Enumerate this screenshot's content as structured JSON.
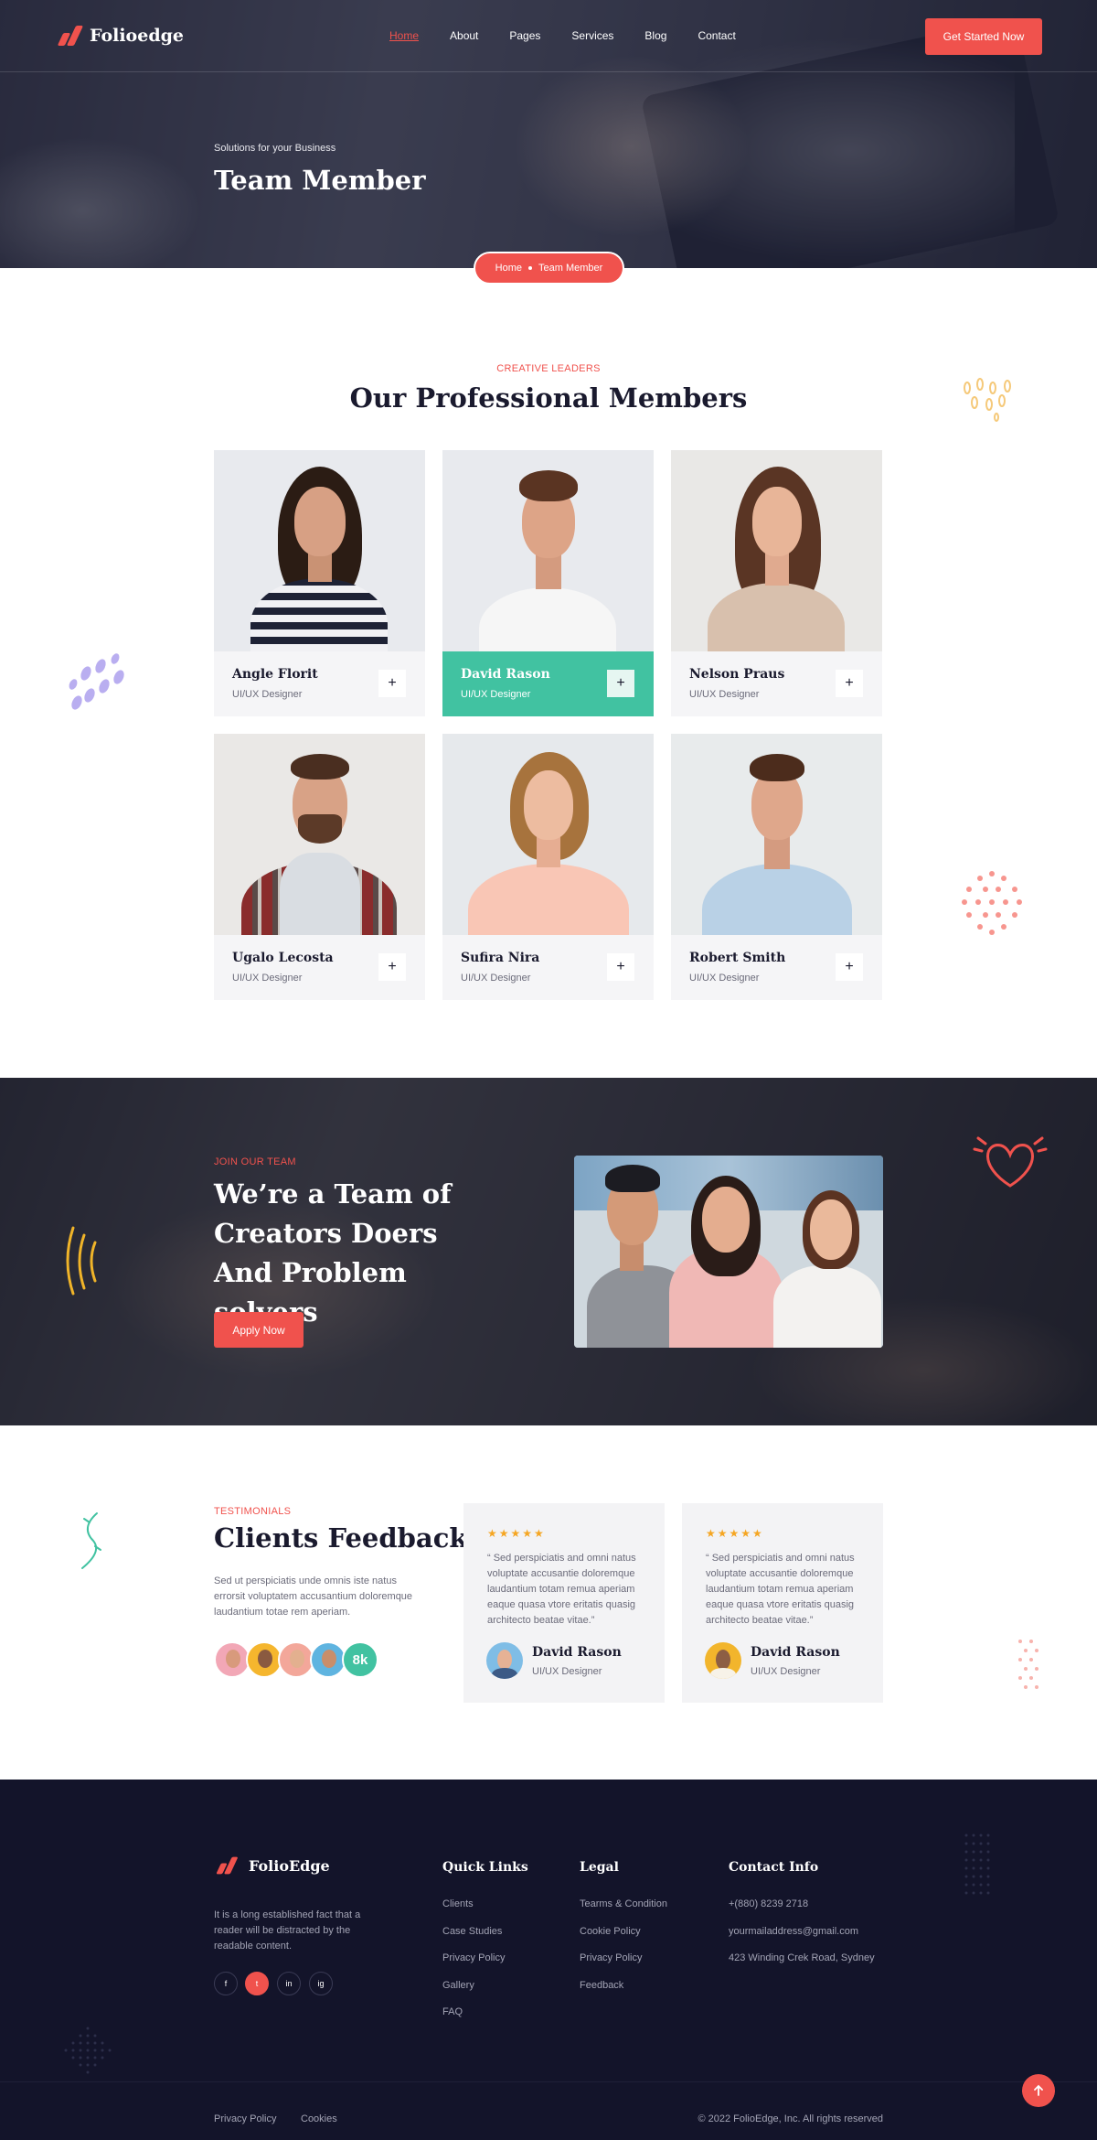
{
  "brand": {
    "name": "Folioedge",
    "accent": "#f0524d",
    "teal": "#41c2a1",
    "dark": "#13142a"
  },
  "nav": {
    "items": [
      {
        "label": "Home",
        "active": true
      },
      {
        "label": "About"
      },
      {
        "label": "Pages"
      },
      {
        "label": "Services"
      },
      {
        "label": "Blog"
      },
      {
        "label": "Contact"
      }
    ],
    "cta": "Get Started Now"
  },
  "hero": {
    "subtitle": "Solutions for your Business",
    "title": "Team Member",
    "breadcrumb": {
      "home": "Home",
      "current": "Team Member"
    }
  },
  "team": {
    "eyebrow": "CREATIVE LEADERS",
    "title": "Our Professional Members",
    "members": [
      {
        "name": "Angle Florit",
        "role": "UI/UX Designer"
      },
      {
        "name": "David Rason",
        "role": "UI/UX Designer"
      },
      {
        "name": "Nelson Praus",
        "role": "UI/UX Designer"
      },
      {
        "name": "Ugalo Lecosta",
        "role": "UI/UX Designer"
      },
      {
        "name": "Sufira Nira",
        "role": "UI/UX Designer"
      },
      {
        "name": "Robert Smith",
        "role": "UI/UX Designer"
      }
    ],
    "plus_icon": "+"
  },
  "join": {
    "eyebrow": "JOIN OUR TEAM",
    "title": "We’re a Team of Creators Doers And Problem solvers",
    "button": "Apply Now"
  },
  "testimonials": {
    "eyebrow": "TESTIMONIALS",
    "title": "Clients Feedback",
    "description": "Sed ut perspiciatis unde omnis iste natus errorsit voluptatem accusantium doloremque laudantium totae rem aperiam.",
    "count": "8k",
    "stars": "★★★★★",
    "items": [
      {
        "quote": "“ Sed perspiciatis and omni natus voluptate accusantie doloremque laudantium totam remua aperiam eaque quasa vtore eritatis quasig architecto beatae vitae.”",
        "name": "David Rason",
        "role": "UI/UX Designer"
      },
      {
        "quote": "“ Sed perspiciatis and omni natus voluptate accusantie doloremque laudantium totam remua aperiam eaque quasa vtore eritatis quasig architecto beatae vitae.”",
        "name": "David Rason",
        "role": "UI/UX Designer"
      }
    ]
  },
  "footer": {
    "brand": "FolioEdge",
    "description": "It is a long established fact that a reader will be distracted by the readable content.",
    "social": [
      "f",
      "t",
      "in",
      "ig"
    ],
    "quick_links": {
      "title": "Quick Links",
      "items": [
        "Clients",
        "Case Studies",
        "Privacy Policy",
        "Gallery",
        "FAQ"
      ]
    },
    "legal": {
      "title": "Legal",
      "items": [
        "Tearms & Condition",
        "Cookie Policy",
        "Privacy Policy",
        "Feedback"
      ]
    },
    "contact": {
      "title": "Contact Info",
      "items": [
        "+(880) 8239 2718",
        "yourmailaddress@gmail.com",
        "423 Winding Crek Road, Sydney"
      ]
    },
    "bottom_links": [
      "Privacy Policy",
      "Cookies"
    ],
    "copyright": "© 2022 FolioEdge, Inc. All rights reserved"
  }
}
